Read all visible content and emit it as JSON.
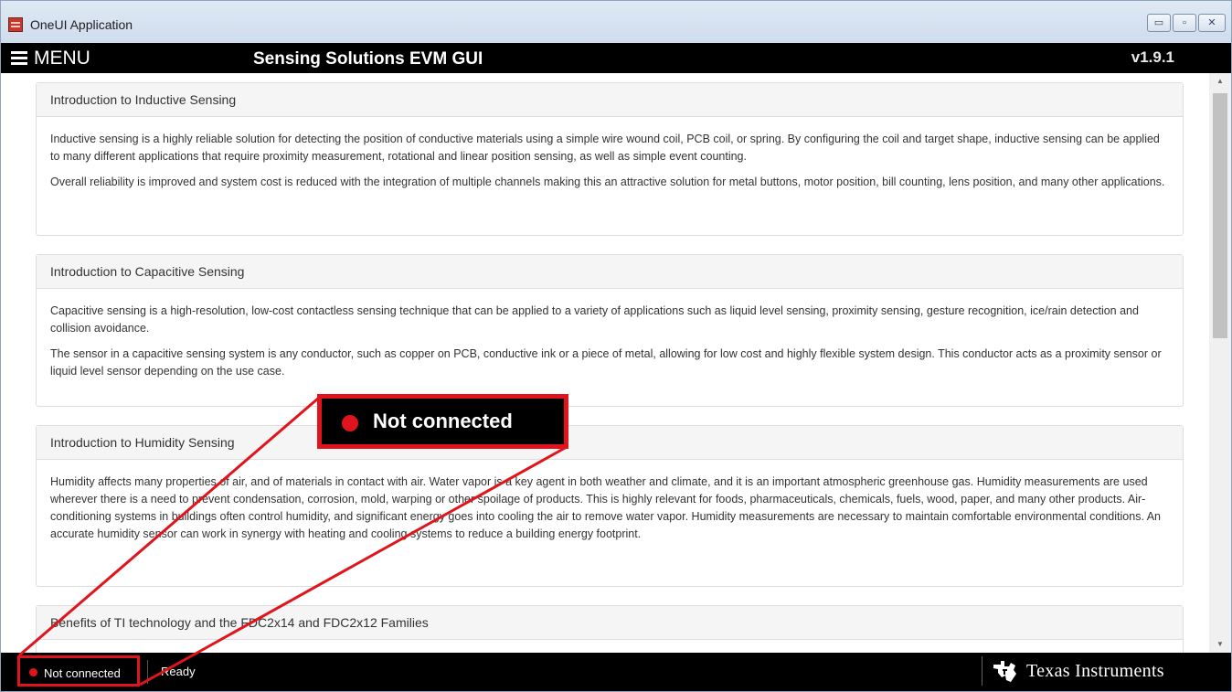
{
  "window": {
    "title": "OneUI Application",
    "min_symbol": "▭",
    "max_symbol": "▫",
    "close_symbol": "✕"
  },
  "header": {
    "menu_label": "MENU",
    "app_title": "Sensing Solutions EVM GUI",
    "version": "v1.9.1"
  },
  "panels": [
    {
      "title": "Introduction to Inductive Sensing",
      "paragraphs": [
        "Inductive sensing is a highly reliable solution for detecting the position of conductive materials using a simple wire wound coil, PCB coil, or spring. By configuring the coil and target shape, inductive sensing can be applied to many different applications that require proximity measurement, rotational and linear position sensing, as well as simple event counting.",
        "Overall reliability is improved and system cost is reduced with the integration of multiple channels making this an attractive solution for metal buttons, motor position, bill counting, lens position, and many other applications."
      ]
    },
    {
      "title": "Introduction to Capacitive Sensing",
      "paragraphs": [
        "Capacitive sensing is a high-resolution, low-cost contactless sensing technique that can be applied to a variety of applications such as liquid level sensing, proximity sensing, gesture recognition, ice/rain detection and collision avoidance.",
        "The sensor in a capacitive sensing system is any conductor, such as copper on PCB, conductive ink or a piece of metal, allowing for low cost and highly flexible system design. This conductor acts as a proximity sensor or liquid level sensor depending on the use case."
      ]
    },
    {
      "title": "Introduction to Humidity Sensing",
      "paragraphs": [
        "Humidity affects many properties of air, and of materials in contact with air. Water vapor is a key agent in both weather and climate, and it is an important atmospheric greenhouse gas. Humidity measurements are used wherever there is a need to prevent condensation, corrosion, mold, warping or other spoilage of products. This is highly relevant for foods, pharmaceuticals, chemicals, fuels, wood, paper, and many other products. Air-conditioning systems in buildings often control humidity, and significant energy goes into cooling the air to remove water vapor. Humidity measurements are necessary to maintain comfortable environmental conditions. An accurate humidity sensor can work in synergy with heating and cooling systems to reduce a building energy footprint."
      ]
    },
    {
      "title": "Benefits of TI technology and the FDC2x14 and FDC2x12 Families",
      "paragraphs": []
    }
  ],
  "scrollbar": {
    "up_arrow": "▲",
    "down_arrow": "▼"
  },
  "statusbar": {
    "connection_status": "Not connected",
    "ready_text": "Ready",
    "brand": "Texas Instruments"
  },
  "callout": {
    "text": "Not connected"
  },
  "colors": {
    "status_red": "#e0141c",
    "header_bg": "#000000",
    "panel_heading_bg": "#f5f5f5"
  }
}
